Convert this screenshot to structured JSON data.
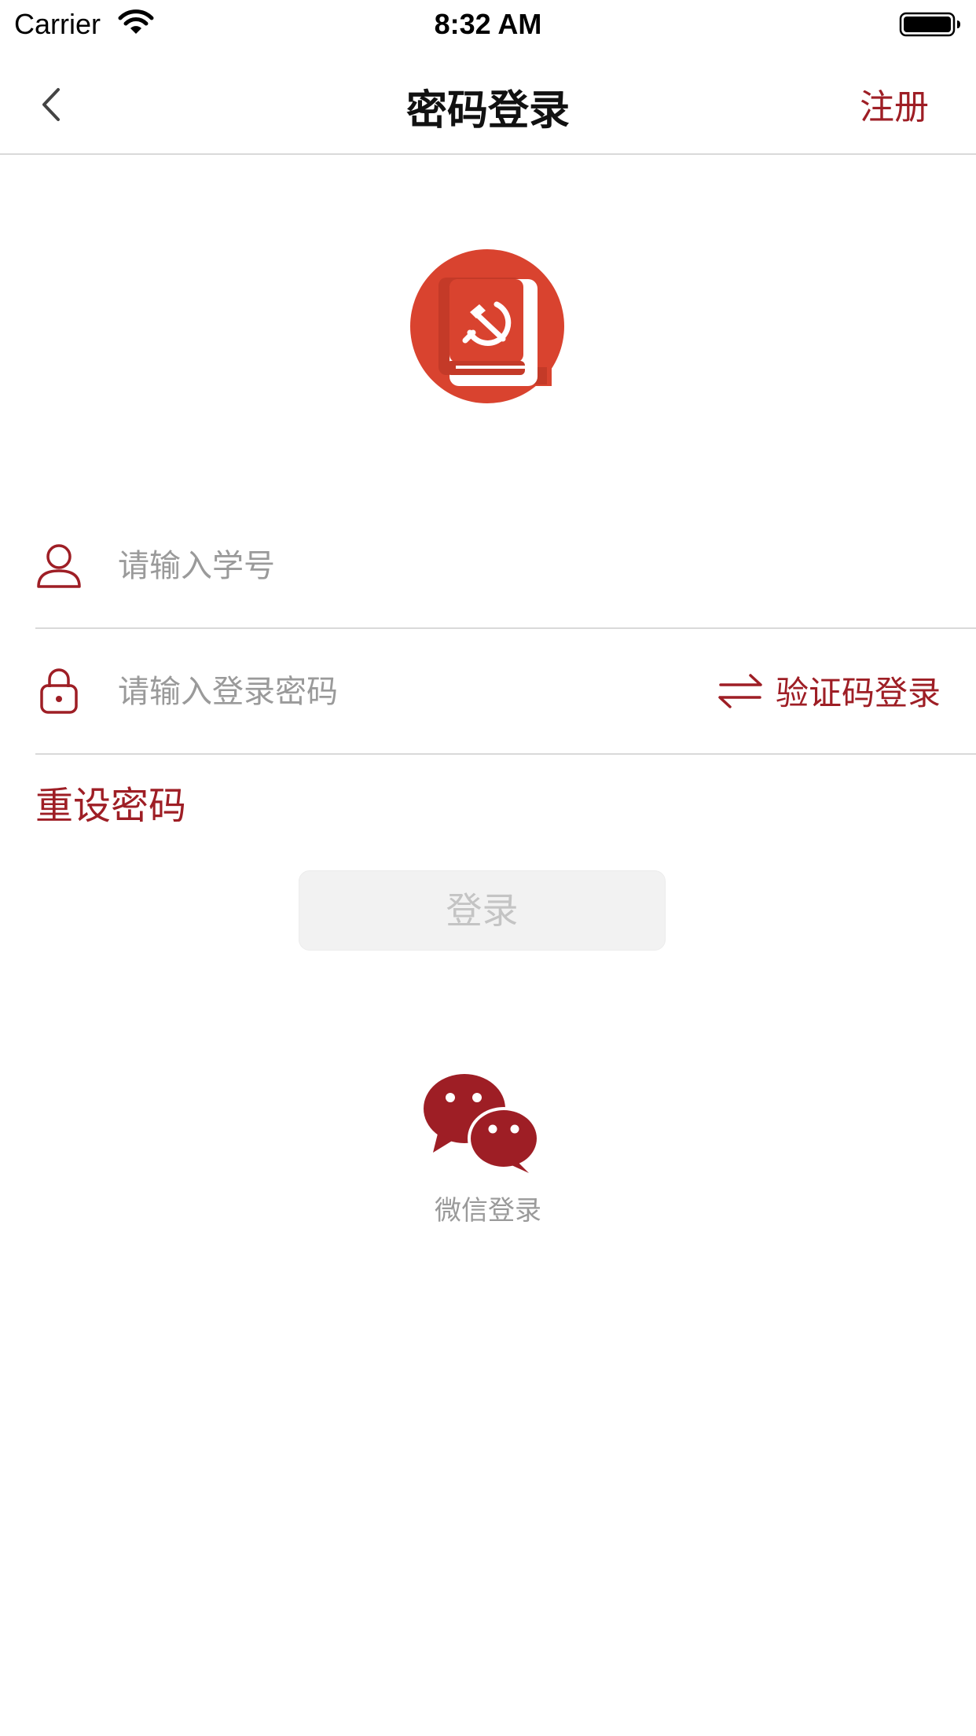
{
  "status_bar": {
    "carrier": "Carrier",
    "time": "8:32 AM",
    "icons": [
      "wifi-icon",
      "battery-icon"
    ]
  },
  "nav": {
    "title": "密码登录",
    "register": "注册",
    "back_icon": "chevron-left-icon"
  },
  "logo": {
    "icon": "party-book-logo"
  },
  "form": {
    "student_id": {
      "placeholder": "请输入学号",
      "value": "",
      "icon": "user-icon"
    },
    "password": {
      "placeholder": "请输入登录密码",
      "value": "",
      "icon": "lock-icon"
    },
    "switch_mode": {
      "label": "验证码登录",
      "icon": "swap-arrows-icon"
    },
    "reset_password": "重设密码",
    "login_button": "登录"
  },
  "wechat": {
    "label": "微信登录",
    "icon": "wechat-icon"
  },
  "colors": {
    "accent": "#9e1e25",
    "logo_bg": "#d9432f",
    "divider": "#d9d9d9",
    "placeholder": "#9a9a9a",
    "button_bg": "#f2f2f2",
    "button_text": "#c4c4c4"
  }
}
